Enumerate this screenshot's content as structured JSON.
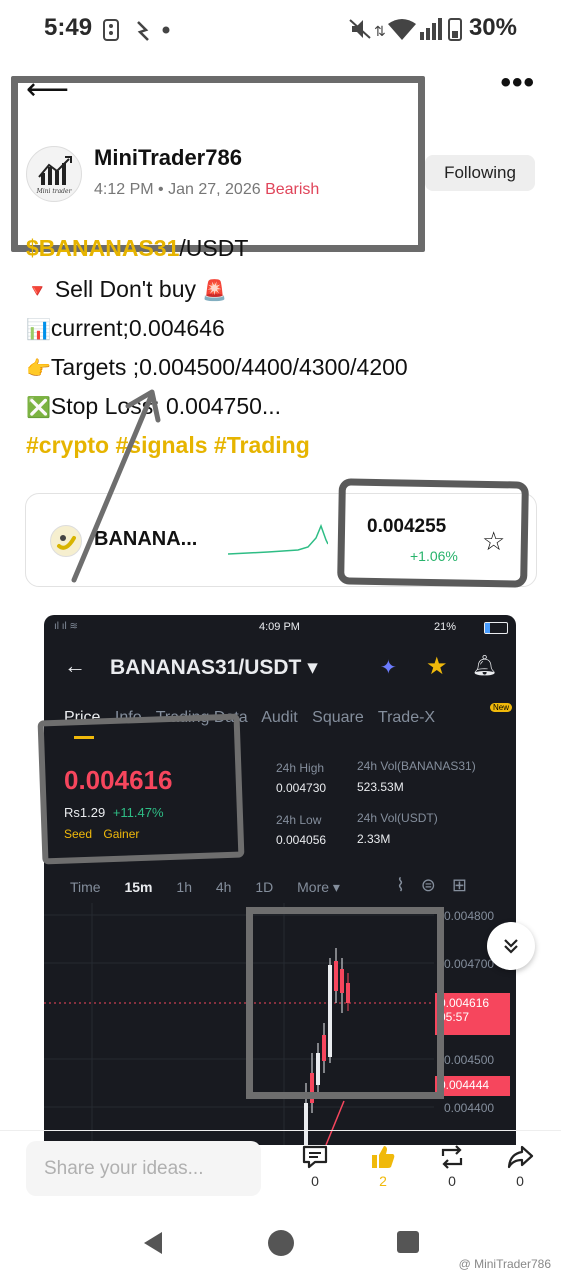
{
  "status_bar": {
    "time": "5:49",
    "battery": "30%"
  },
  "post": {
    "author": "MiniTrader786",
    "time": "4:12 PM",
    "date": "Jan 27, 2026",
    "sentiment": "Bearish",
    "follow_label": "Following",
    "pair_ticker": "$BANANAS31",
    "pair_quote": "/USDT",
    "line_sell": "Sell Don't buy",
    "line_current": "current;0.004646",
    "line_targets": "Targets ;0.004500/4400/4300/4200",
    "line_stop": "Stop Loss; 0.004750...",
    "hashtags": [
      "#crypto",
      "#signals",
      "#Trading"
    ]
  },
  "coin_card": {
    "name": "BANANA...",
    "price": "0.004255",
    "change": "+1.06%"
  },
  "embedded": {
    "status_time": "4:09 PM",
    "status_battery": "21",
    "pair": "BANANAS31/USDT",
    "tabs": [
      "Price",
      "Info",
      "Trading Data",
      "Audit",
      "Square",
      "Trade-X"
    ],
    "new_badge": "New",
    "price": "0.004616",
    "fiat": "Rs1.29",
    "change": "+11.47%",
    "tags": [
      "Seed",
      "Gainer"
    ],
    "high_label": "24h High",
    "high_value": "0.004730",
    "vol_base_label": "24h Vol(BANANAS31)",
    "vol_base_value": "523.53M",
    "low_label": "24h Low",
    "low_value": "0.004056",
    "vol_quote_label": "24h Vol(USDT)",
    "vol_quote_value": "2.33M",
    "intervals": [
      "Time",
      "15m",
      "1h",
      "4h",
      "1D",
      "More"
    ],
    "axis": [
      "0.004800",
      "0.004700",
      "0.004500",
      "0.004400"
    ],
    "current_price_tag": "0.004616",
    "countdown": "05:57",
    "low_tag": "0.004444"
  },
  "composer": {
    "placeholder": "Share your ideas..."
  },
  "actions": {
    "comments": "0",
    "likes": "2",
    "reposts": "0",
    "shares": "0"
  },
  "watermark": "@ MiniTrader786",
  "colors": {
    "bearish": "#e0455a",
    "gold": "#e6b400",
    "up": "#2ebd85",
    "down": "#f6465d"
  }
}
